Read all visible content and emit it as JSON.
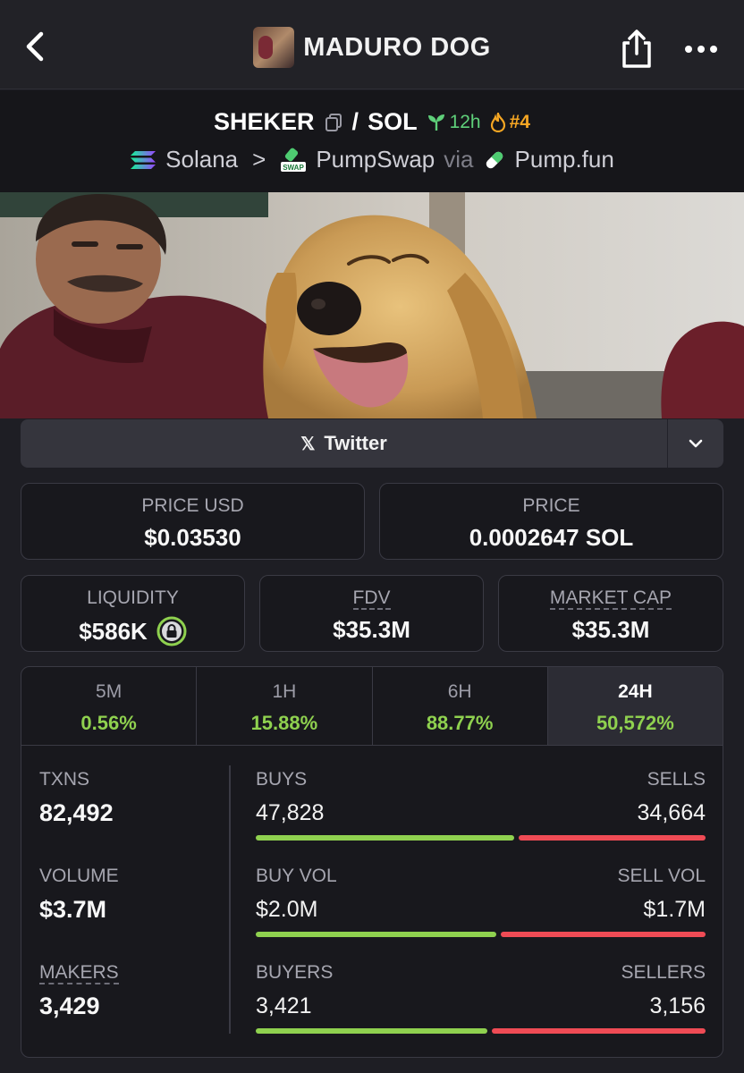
{
  "header": {
    "title": "MADURO DOG"
  },
  "pair": {
    "base": "SHEKER",
    "separator": "/",
    "quote": "SOL",
    "age": "12h",
    "rank": "#4",
    "chain": "Solana",
    "chevron": ">",
    "dex": "PumpSwap",
    "swap_badge": "SWAP",
    "via": "via",
    "launchpad": "Pump.fun"
  },
  "links": {
    "twitter_label": "Twitter",
    "twitter_glyph": "𝕏"
  },
  "price": {
    "usd_label": "PRICE USD",
    "usd_value": "$0.03530",
    "native_label": "PRICE",
    "native_value": "0.0002647 SOL"
  },
  "metrics": {
    "liquidity_label": "LIQUIDITY",
    "liquidity_value": "$586K",
    "fdv_label": "FDV",
    "fdv_value": "$35.3M",
    "mcap_label": "MARKET CAP",
    "mcap_value": "$35.3M"
  },
  "timeframes": [
    {
      "label": "5M",
      "change": "0.56%"
    },
    {
      "label": "1H",
      "change": "15.88%"
    },
    {
      "label": "6H",
      "change": "88.77%"
    },
    {
      "label": "24H",
      "change": "50,572%"
    }
  ],
  "activity": {
    "txns_label": "TXNS",
    "txns_value": "82,492",
    "volume_label": "VOLUME",
    "volume_value": "$3.7M",
    "makers_label": "MAKERS",
    "makers_value": "3,429",
    "buys_label": "BUYS",
    "buys_value": "47,828",
    "sells_label": "SELLS",
    "sells_value": "34,664",
    "buys_fraction": 0.58,
    "buyvol_label": "BUY VOL",
    "buyvol_value": "$2.0M",
    "sellvol_label": "SELL VOL",
    "sellvol_value": "$1.7M",
    "buyvol_fraction": 0.54,
    "buyers_label": "BUYERS",
    "buyers_value": "3,421",
    "sellers_label": "SELLERS",
    "sellers_value": "3,156",
    "buyers_fraction": 0.52
  },
  "colors": {
    "positive": "#8fd14f",
    "negative": "#ef4b55",
    "age": "#5fd07a",
    "rank": "#f5a623"
  }
}
